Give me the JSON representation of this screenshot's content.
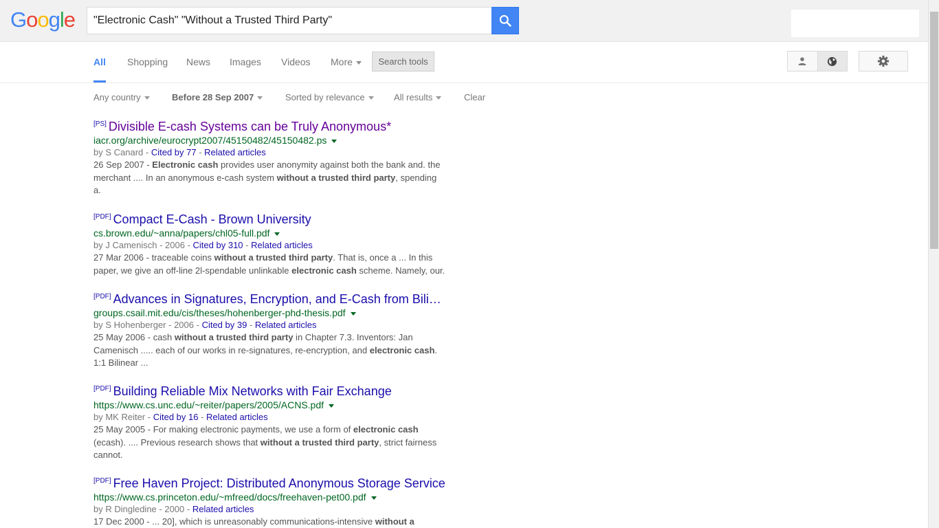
{
  "logo": {
    "letters": [
      "G",
      "o",
      "o",
      "g",
      "l",
      "e"
    ]
  },
  "search": {
    "query": "\"Electronic Cash\" \"Without a Trusted Third Party\"",
    "button_icon": "search-icon"
  },
  "tabs": [
    {
      "label": "All",
      "active": true
    },
    {
      "label": "Shopping"
    },
    {
      "label": "News"
    },
    {
      "label": "Images"
    },
    {
      "label": "Videos"
    },
    {
      "label": "More"
    }
  ],
  "search_tools_label": "Search tools",
  "filters": {
    "country": "Any country",
    "date": "Before 28 Sep 2007",
    "sort": "Sorted by relevance",
    "results": "All results",
    "clear": "Clear"
  },
  "results": [
    {
      "filetype": "[PS]",
      "title": "Divisible E-cash Systems can be Truly Anonymous*",
      "visited": true,
      "url": "iacr.org/archive/eurocrypt2007/45150482/45150482.ps",
      "author": "by S Canard",
      "year": "",
      "cited": "Cited by 77",
      "related": "Related articles",
      "snippet_date": "26 Sep 2007",
      "snippet": [
        {
          "t": "Electronic cash",
          "b": true
        },
        {
          "t": " provides user anonymity against both the bank and. the merchant .... In an anonymous e-cash system ",
          "b": false
        },
        {
          "t": "without a trusted third party",
          "b": true
        },
        {
          "t": ", spending a.",
          "b": false
        }
      ]
    },
    {
      "filetype": "[PDF]",
      "title": "Compact E-Cash - Brown University",
      "visited": false,
      "url": "cs.brown.edu/~anna/papers/chl05-full.pdf",
      "author": "by J Camenisch",
      "year": "2006",
      "cited": "Cited by 310",
      "related": "Related articles",
      "snippet_date": "27 Mar 2006",
      "snippet": [
        {
          "t": "traceable coins ",
          "b": false
        },
        {
          "t": "without a trusted third party",
          "b": true
        },
        {
          "t": ". That is, once a ... In this paper, we give an off-line 2l-spendable unlinkable ",
          "b": false
        },
        {
          "t": "electronic cash",
          "b": true
        },
        {
          "t": " scheme. Namely, our.",
          "b": false
        }
      ]
    },
    {
      "filetype": "[PDF]",
      "title": "Advances in Signatures, Encryption, and E-Cash from Bilinear Groups",
      "visited": false,
      "url": "groups.csail.mit.edu/cis/theses/hohenberger-phd-thesis.pdf",
      "author": "by S Hohenberger",
      "year": "2006",
      "cited": "Cited by 39",
      "related": "Related articles",
      "snippet_date": "25 May 2006",
      "snippet": [
        {
          "t": "cash ",
          "b": false
        },
        {
          "t": "without a trusted third party",
          "b": true
        },
        {
          "t": " in Chapter 7.3. Inventors: Jan Camenisch ..... each of our works in re-signatures, re-encryption, and ",
          "b": false
        },
        {
          "t": "electronic cash",
          "b": true
        },
        {
          "t": ". 1:1 Bilinear ...",
          "b": false
        }
      ]
    },
    {
      "filetype": "[PDF]",
      "title": "Building Reliable Mix Networks with Fair Exchange",
      "visited": false,
      "url": "https://www.cs.unc.edu/~reiter/papers/2005/ACNS.pdf",
      "author": "by MK Reiter",
      "year": "",
      "cited": "Cited by 16",
      "related": "Related articles",
      "snippet_date": "25 May 2005",
      "snippet": [
        {
          "t": "For making electronic payments, we use a form of ",
          "b": false
        },
        {
          "t": "electronic cash",
          "b": true
        },
        {
          "t": " (ecash). .... Previous research shows that ",
          "b": false
        },
        {
          "t": "without a trusted third party",
          "b": true
        },
        {
          "t": ", strict fairness cannot.",
          "b": false
        }
      ]
    },
    {
      "filetype": "[PDF]",
      "title": "Free Haven Project: Distributed Anonymous Storage Service",
      "visited": false,
      "url": "https://www.cs.princeton.edu/~mfreed/docs/freehaven-pet00.pdf",
      "author": "by R Dingledine",
      "year": "2000",
      "cited": "",
      "related": "Related articles",
      "snippet_date": "17 Dec 2000",
      "snippet": [
        {
          "t": "... 20], which is unreasonably communications-intensive ",
          "b": false
        },
        {
          "t": "without a",
          "b": true
        }
      ]
    }
  ],
  "colors": {
    "blue": "#4285f4",
    "red": "#ea4335",
    "yellow": "#fbbc05",
    "green": "#34a853",
    "link": "#1a0dab",
    "visited": "#660099",
    "url": "#006621"
  }
}
